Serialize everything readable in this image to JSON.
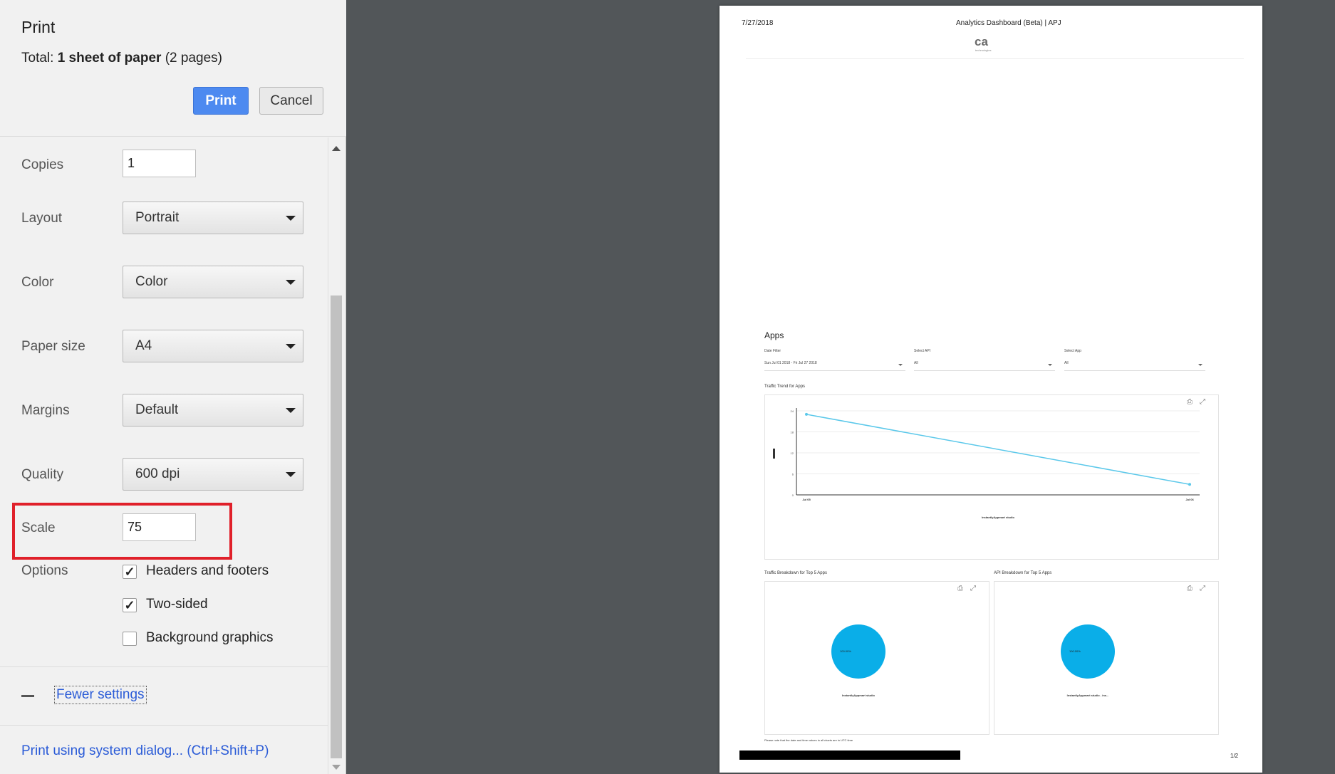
{
  "header": {
    "title": "Print",
    "total_prefix": "Total: ",
    "total_bold": "1 sheet of paper",
    "total_suffix": " (2 pages)",
    "print_label": "Print",
    "cancel_label": "Cancel"
  },
  "settings": {
    "copies": {
      "label": "Copies",
      "value": "1"
    },
    "layout": {
      "label": "Layout",
      "value": "Portrait"
    },
    "color": {
      "label": "Color",
      "value": "Color"
    },
    "paper_size": {
      "label": "Paper size",
      "value": "A4"
    },
    "margins": {
      "label": "Margins",
      "value": "Default"
    },
    "quality": {
      "label": "Quality",
      "value": "600 dpi"
    },
    "scale": {
      "label": "Scale",
      "value": "75"
    },
    "options": {
      "label": "Options",
      "items": [
        {
          "label": "Headers and footers",
          "checked": true
        },
        {
          "label": "Two-sided",
          "checked": true
        },
        {
          "label": "Background graphics",
          "checked": false
        }
      ]
    }
  },
  "footer": {
    "fewer_settings": "Fewer settings",
    "system_dialog": "Print using system dialog... (Ctrl+Shift+P)"
  },
  "colors": {
    "print_button": "#4d8af0",
    "link": "#2a5bd7",
    "highlight": "#e0202a",
    "preview_background": "#525659",
    "line_series": "#5bc8ea",
    "pie_fill": "#0aaee8"
  },
  "preview": {
    "date": "7/27/2018",
    "title": "Analytics Dashboard (Beta) | APJ",
    "logo": "ca",
    "logo_sub": "technologies",
    "section_title": "Apps",
    "filters": [
      {
        "label": "Date Filter",
        "value": "Sun Jul 01 2018 - Fri Jul 27 2018"
      },
      {
        "label": "Select API",
        "value": "All"
      },
      {
        "label": "Select App",
        "value": "All"
      }
    ],
    "traffic_trend_title": "Traffic Trend for Apps",
    "traffic_breakdown_title": "Traffic Breakdown for Top 5 Apps",
    "api_breakdown_title": "API Breakdown for Top 5 Apps",
    "footnote": "Please note that the date and time values in all charts are in UTC time",
    "page_number": "1/2"
  },
  "chart_data": [
    {
      "type": "line",
      "title": "Traffic Trend for Apps",
      "x": [
        "Jul 05",
        "Jul 06"
      ],
      "ylim": [
        0,
        24
      ],
      "y_ticks": [
        "0",
        "6",
        "12",
        "18",
        "24"
      ],
      "series": [
        {
          "name": "InstantlyAppmart studio",
          "values": [
            23,
            3
          ]
        }
      ],
      "xlabel": "",
      "ylabel": "",
      "grid": true,
      "legend": "bottom"
    },
    {
      "type": "pie",
      "title": "Traffic Breakdown for Top 5 Apps",
      "slices": [
        {
          "name": "InstantlyAppmart studio",
          "value": 100,
          "label": "100.00%"
        }
      ],
      "legend": "bottom"
    },
    {
      "type": "pie",
      "title": "API Breakdown for Top 5 Apps",
      "slices": [
        {
          "name": "InstantlyAppmart studio - ins...",
          "value": 100,
          "label": "100.00%"
        }
      ],
      "legend": "bottom"
    }
  ]
}
